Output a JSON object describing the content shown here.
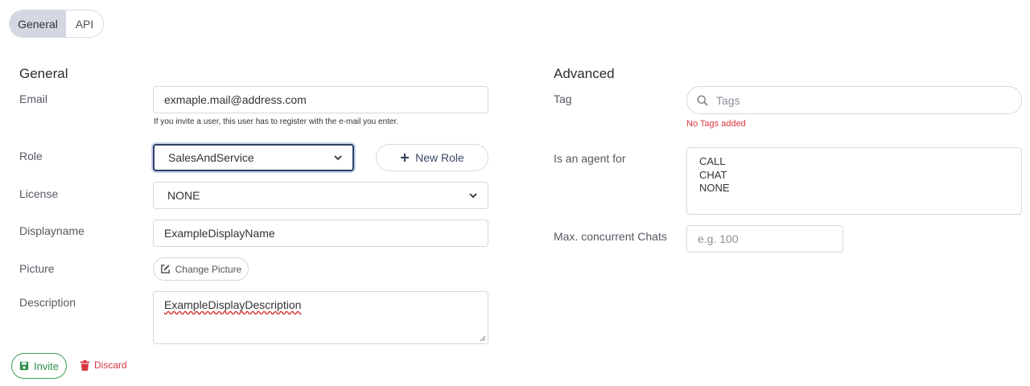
{
  "tabs": [
    {
      "label": "General",
      "active": true
    },
    {
      "label": "API",
      "active": false
    }
  ],
  "general": {
    "title": "General",
    "email": {
      "label": "Email",
      "value": "exmaple.mail@address.com",
      "hint": "If you invite a user, this user has to register with the e-mail you enter."
    },
    "role": {
      "label": "Role",
      "selected": "SalesAndService",
      "new_role_label": "New Role"
    },
    "license": {
      "label": "License",
      "selected": "NONE"
    },
    "displayname": {
      "label": "Displayname",
      "value": "ExampleDisplayName"
    },
    "picture": {
      "label": "Picture",
      "button_label": "Change Picture"
    },
    "description": {
      "label": "Description",
      "value": "ExampleDisplayDescription"
    }
  },
  "advanced": {
    "title": "Advanced",
    "tag": {
      "label": "Tag",
      "placeholder": "Tags",
      "empty_message": "No Tags added"
    },
    "agent_for": {
      "label": "Is an agent for",
      "options": [
        "CALL",
        "CHAT",
        "NONE"
      ]
    },
    "max_chats": {
      "label": "Max. concurrent Chats",
      "placeholder": "e.g. 100"
    }
  },
  "actions": {
    "invite_label": "Invite",
    "discard_label": "Discard"
  },
  "colors": {
    "accent": "#2c3e66",
    "success": "#3aa05b",
    "danger": "#d9373f",
    "active_tab": "#d3d7e1"
  },
  "icons": [
    "search-icon",
    "plus-icon",
    "edit-icon",
    "save-icon",
    "trash-icon",
    "chevron-down-icon"
  ]
}
